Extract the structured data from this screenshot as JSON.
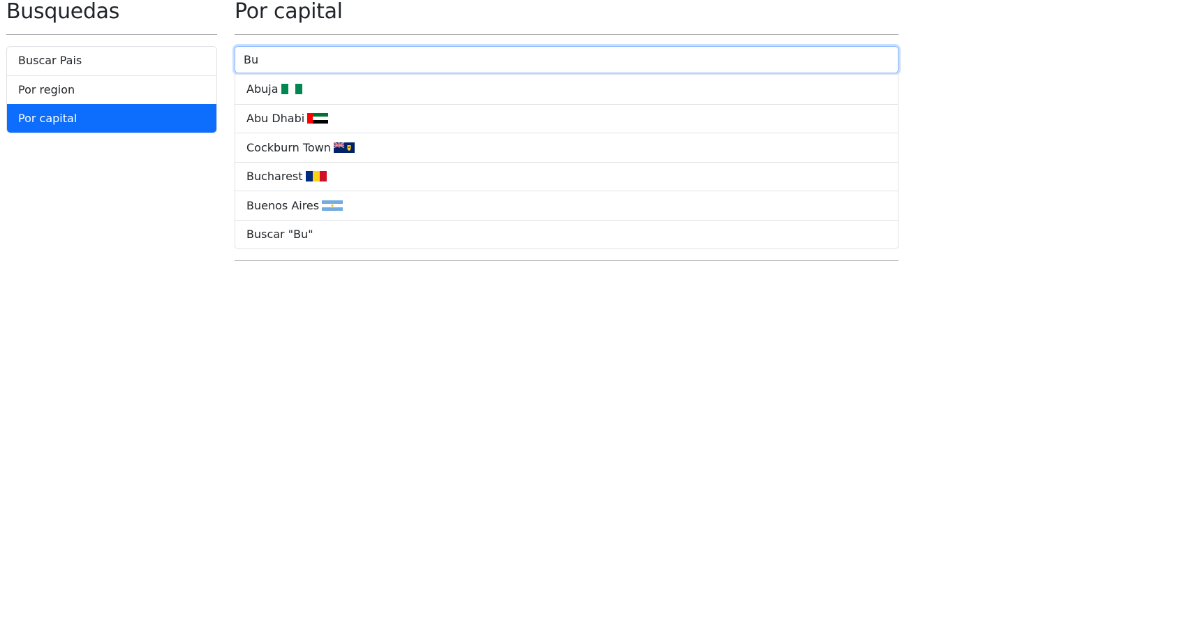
{
  "sidebar": {
    "title": "Busquedas",
    "items": [
      {
        "label": "Buscar Pais",
        "active": false
      },
      {
        "label": "Por region",
        "active": false
      },
      {
        "label": "Por capital",
        "active": true
      }
    ]
  },
  "main": {
    "title": "Por capital",
    "search": {
      "value": "Bu",
      "placeholder": ""
    },
    "suggestions": [
      {
        "label": "Abuja",
        "flag_icon": "nigeria-flag-icon"
      },
      {
        "label": "Abu Dhabi",
        "flag_icon": "uae-flag-icon"
      },
      {
        "label": "Cockburn Town",
        "flag_icon": "turks-caicos-flag-icon"
      },
      {
        "label": "Bucharest",
        "flag_icon": "romania-flag-icon"
      },
      {
        "label": "Buenos Aires",
        "flag_icon": "argentina-flag-icon"
      }
    ],
    "search_option": "Buscar \"Bu\""
  },
  "colors": {
    "accent": "#0d6efd",
    "focus_border": "#86b7fe"
  }
}
